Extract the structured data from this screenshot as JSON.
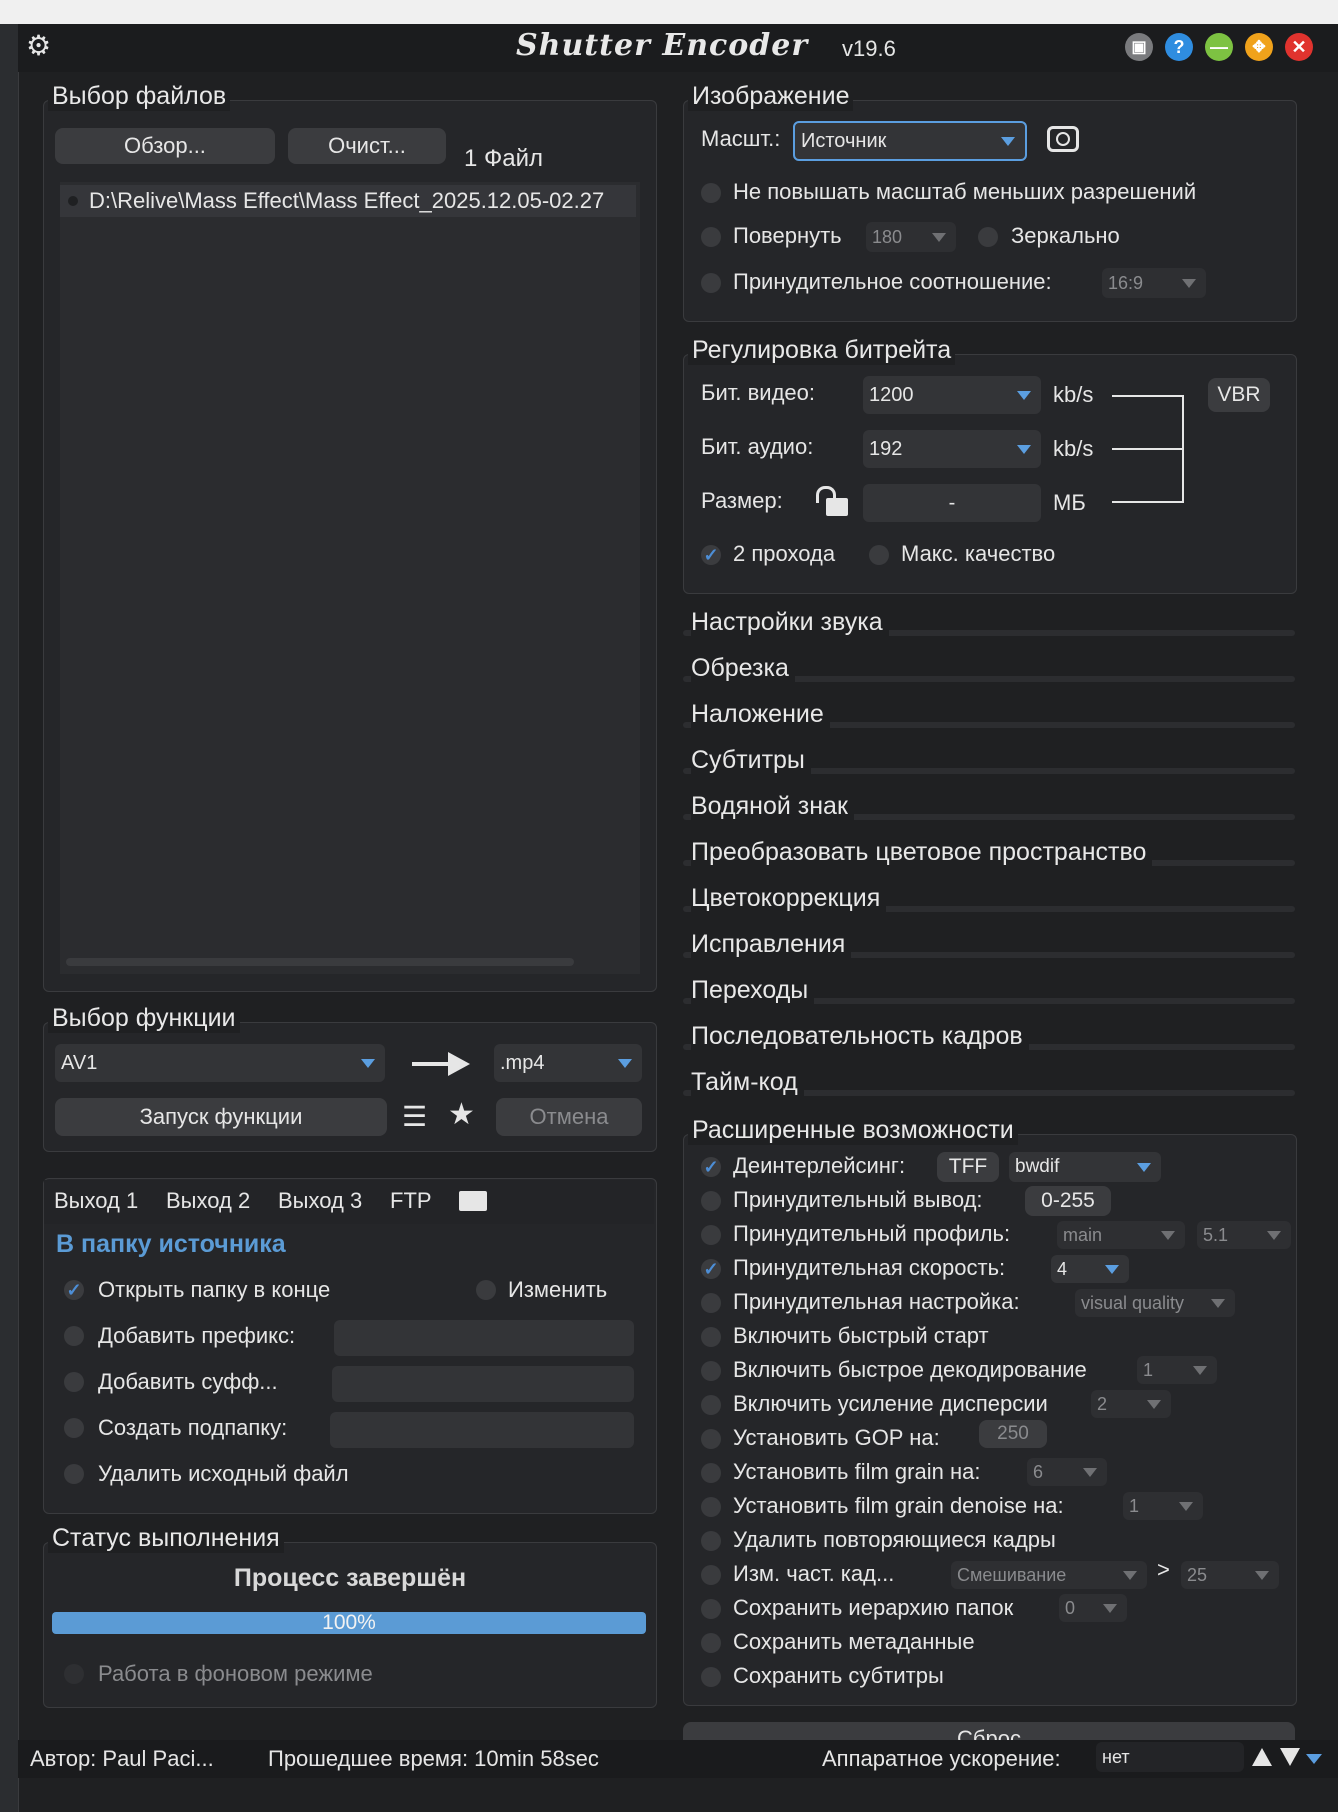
{
  "app": {
    "name": "Shutter Encoder",
    "version": "v19.6"
  },
  "icons": {
    "settings": "gear-icon",
    "collapse": "collapse-icon",
    "help": "help-icon",
    "minimize": "minimize-icon",
    "maximize": "maximize-icon",
    "close": "close-icon"
  },
  "colors": {
    "accent": "#4d8ed6",
    "help": "#2f8de0",
    "minimize": "#7dc242",
    "maximize": "#f0a21b",
    "close": "#e0332e",
    "progress": "#5b9bd5"
  },
  "file_selection": {
    "label": "Выбор файлов",
    "browse": "Обзор...",
    "clear": "Очист...",
    "count": "1 Файл",
    "files": [
      "D:\\Relive\\Mass Effect\\Mass Effect_2025.12.05-02.27"
    ]
  },
  "function_selection": {
    "label": "Выбор функции",
    "function": "AV1",
    "extension": ".mp4",
    "start": "Запуск функции",
    "cancel": "Отмена"
  },
  "output": {
    "tabs": [
      "Выход 1",
      "Выход 2",
      "Выход 3",
      "FTP"
    ],
    "destination": "В папку источника",
    "open_folder": "Открыть папку в конце",
    "change": "Изменить",
    "add_prefix": "Добавить префикс:",
    "add_suffix": "Добавить суфф...",
    "create_subfolder": "Создать подпапку:",
    "delete_source": "Удалить исходный файл"
  },
  "status": {
    "label": "Статус выполнения",
    "message": "Процесс завершён",
    "progress_text": "100%",
    "progress": 1.0,
    "background": "Работа в фоновом режиме"
  },
  "image": {
    "label": "Изображение",
    "scale_label": "Масшт.:",
    "scale_value": "Источник",
    "no_upscale": "Не повышать масштаб меньших разрешений",
    "rotate": "Повернуть",
    "rotate_value": "180",
    "mirror": "Зеркально",
    "force_ratio": "Принудительное соотношение:",
    "ratio_value": "16:9"
  },
  "bitrate": {
    "label": "Регулировка битрейта",
    "video_label": "Бит. видео:",
    "video_value": "1200",
    "audio_label": "Бит. аудио:",
    "audio_value": "192",
    "unit": "kb/s",
    "size_label": "Размер:",
    "size_value": "-",
    "size_unit": "МБ",
    "mode": "VBR",
    "two_pass": "2 прохода",
    "max_quality": "Макс. качество"
  },
  "sections": [
    "Настройки звука",
    "Обрезка",
    "Наложение",
    "Субтитры",
    "Водяной знак",
    "Преобразовать цветовое пространство",
    "Цветокоррекция",
    "Исправления",
    "Переходы",
    "Последовательность кадров",
    "Тайм-код"
  ],
  "advanced": {
    "label": "Расширенные возможности",
    "deinterlace": "Деинтерлейсинг:",
    "deinterlace_field": "TFF",
    "deinterlace_filter": "bwdif",
    "force_output": "Принудительный вывод:",
    "force_output_value": "0-255",
    "force_profile": "Принудительный профиль:",
    "profile_value": "main",
    "level_value": "5.1",
    "force_speed": "Принудительная скорость:",
    "speed_value": "4",
    "force_tune": "Принудительная настройка:",
    "tune_value": "visual quality",
    "fast_start": "Включить быстрый старт",
    "fast_decode": "Включить быстрое декодирование",
    "fast_decode_value": "1",
    "variance_boost": "Включить усиление дисперсии",
    "variance_value": "2",
    "gop": "Установить GOP на:",
    "gop_value": "250",
    "film_grain": "Установить film grain на:",
    "film_grain_value": "6",
    "film_grain_denoise": "Установить film grain denoise на:",
    "denoise_value": "1",
    "remove_duplicates": "Удалить повторяющиеся кадры",
    "change_fps": "Изм. част. кад...",
    "fps_mode": "Смешивание",
    "fps_gt": ">",
    "fps_value": "25",
    "keep_hierarchy": "Сохранить иерархию папок",
    "hierarchy_value": "0",
    "keep_metadata": "Сохранить метаданные",
    "keep_subtitles": "Сохранить субтитры",
    "cut_button": "Сброс"
  },
  "footer": {
    "author": "Автор: Paul Paci...",
    "elapsed": "Прошедшее время: 10min 58sec",
    "hw_label": "Аппаратное ускорение:",
    "hw_value": "нет"
  }
}
